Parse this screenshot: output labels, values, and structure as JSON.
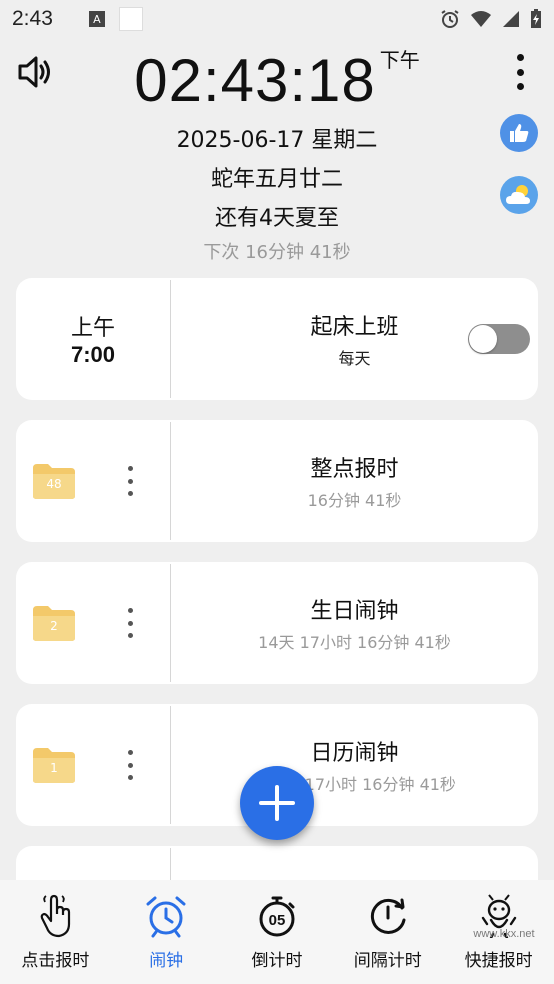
{
  "status_bar": {
    "time": "2:43",
    "a_badge": "A",
    "icons": [
      "alarm-icon",
      "wifi-icon",
      "signal-icon",
      "battery-charging-icon"
    ]
  },
  "header": {
    "time": "02:43:18",
    "ampm": "下午",
    "date": "2025-06-17 星期二",
    "lunar": "蛇年五月廿二",
    "solar_term": "还有4天夏至",
    "next": "下次  16分钟 41秒"
  },
  "alarm_card": {
    "ampm": "上午",
    "time": "7:00",
    "title": "起床上班",
    "repeat": "每天",
    "enabled": false
  },
  "folders": [
    {
      "count": "48",
      "title": "整点报时",
      "sub": "16分钟 41秒"
    },
    {
      "count": "2",
      "title": "生日闹钟",
      "sub": "14天 17小时 16分钟 41秒"
    },
    {
      "count": "1",
      "title": "日历闹钟",
      "sub": "501天 17小时 16分钟 41秒"
    }
  ],
  "nav": [
    {
      "label": "点击报时",
      "icon": "tap-hand-icon"
    },
    {
      "label": "闹钟",
      "icon": "alarm-clock-icon",
      "active": true
    },
    {
      "label": "倒计时",
      "icon": "stopwatch-icon"
    },
    {
      "label": "间隔计时",
      "icon": "interval-timer-icon"
    },
    {
      "label": "快捷报时",
      "icon": "mascot-icon"
    }
  ],
  "watermark": "www.kkx.net",
  "colors": {
    "accent": "#2a6fe6",
    "folder": "#f3c96a",
    "background": "#efefef"
  }
}
